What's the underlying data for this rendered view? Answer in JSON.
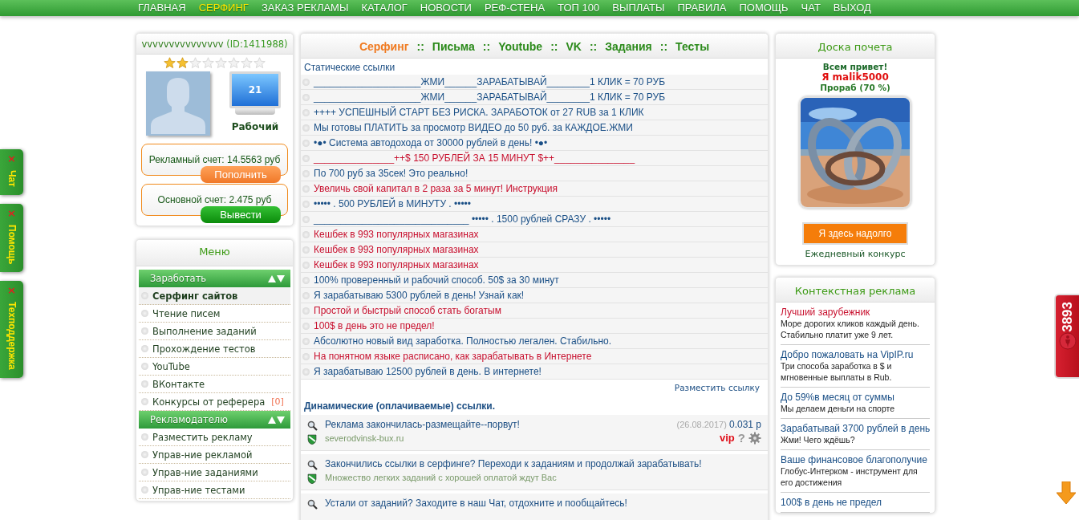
{
  "nav": [
    {
      "label": "ГЛАВНАЯ",
      "selected": false
    },
    {
      "label": "СЕРФИНГ",
      "selected": true
    },
    {
      "label": "ЗАКАЗ РЕКЛАМЫ",
      "selected": false
    },
    {
      "label": "КАТАЛОГ",
      "selected": false
    },
    {
      "label": "НОВОСТИ",
      "selected": false
    },
    {
      "label": "РЕФ-СТЕНА",
      "selected": false
    },
    {
      "label": "ТОП 100",
      "selected": false
    },
    {
      "label": "ВЫПЛАТЫ",
      "selected": false
    },
    {
      "label": "ПРАВИЛА",
      "selected": false
    },
    {
      "label": "ПОМОЩЬ",
      "selected": false
    },
    {
      "label": "ЧАТ",
      "selected": false
    },
    {
      "label": "ВЫХОД",
      "selected": false
    }
  ],
  "side_tabs": [
    {
      "label": "Чат",
      "close": "×"
    },
    {
      "label": "Помощь",
      "close": "×"
    },
    {
      "label": "Техподдержка",
      "close": "×"
    }
  ],
  "profile": {
    "username": "vvvvvvvvvvvvvvv",
    "id": "(ID:1411988)",
    "stars": 2,
    "monitor_value": "21",
    "status": "Рабочий",
    "accounts": [
      {
        "label": "Рекламный счет: 14.5563 руб",
        "button": "Пополнить",
        "kind": "deposit"
      },
      {
        "label": "Основной счет: 2.475 руб",
        "button": "Вывести",
        "kind": "withdraw"
      }
    ]
  },
  "menu": {
    "title": "Меню",
    "groups": [
      {
        "title": "Заработать",
        "items": [
          {
            "label": "Серфинг сайтов",
            "selected": true
          },
          {
            "label": "Чтение писем",
            "selected": false
          },
          {
            "label": "Выполнение заданий",
            "selected": false
          },
          {
            "label": "Прохождение тестов",
            "selected": false
          },
          {
            "label": "YouTube",
            "selected": false
          },
          {
            "label": "ВКонтакте",
            "selected": false
          },
          {
            "label": "Конкурсы от реферера",
            "selected": false,
            "badge": "[0]"
          }
        ]
      },
      {
        "title": "Рекламодателю",
        "items": [
          {
            "label": "Разместить рекламу",
            "selected": false
          },
          {
            "label": "Управ-ние рекламой",
            "selected": false
          },
          {
            "label": "Управ-ние заданиями",
            "selected": false
          },
          {
            "label": "Управ-ние тестами",
            "selected": false
          }
        ]
      }
    ]
  },
  "tabs": [
    {
      "label": "Серфинг",
      "selected": true
    },
    {
      "label": "Письма",
      "selected": false
    },
    {
      "label": "Youtube",
      "selected": false
    },
    {
      "label": "VK",
      "selected": false
    },
    {
      "label": "Задания",
      "selected": false
    },
    {
      "label": "Тесты",
      "selected": false
    }
  ],
  "tab_separator": "::",
  "static_links": {
    "title": "Статические ссылки",
    "place_link": "Разместить ссылку",
    "items": [
      {
        "text": "____________________ЖМИ______ЗАРАБАТЫВАЙ________1 КЛИК = 70 РУБ",
        "color": "#1a4f86"
      },
      {
        "text": "____________________ЖМИ______ЗАРАБАТЫВАЙ________1 КЛИК = 70 РУБ",
        "color": "#1a4f86"
      },
      {
        "text": "++++ УСПЕШНЫЙ СТАРТ БЕЗ РИСКА. ЗАРАБОТОК от 27 RUB за 1 КЛИК",
        "color": "#1a4f86"
      },
      {
        "text": "Мы готовы ПЛАТИТЬ за просмотр ВИДЕО до 50 руб. за КАЖДОЕ.ЖМИ",
        "color": "#1a4f86"
      },
      {
        "text": "•●• Система автодохода от 30000 рублей в день! •●•",
        "color": "#1a4f86"
      },
      {
        "text": "_______________++$ 150 РУБЛЕЙ ЗА 15 МИНУТ $++_______________",
        "color": "#c8102e"
      },
      {
        "text": "По 700 руб за 35сек! Это реально!",
        "color": "#1a4f86"
      },
      {
        "text": "Увеличь свой капитал в 2 раза за 5 минут! Инструкция",
        "color": "#c8102e"
      },
      {
        "text": "••••• . 500 РУБЛЕЙ в МИНУТУ . •••••",
        "color": "#1a4f86"
      },
      {
        "text": "_____________________________ ••••• . 1500 рублей СРАЗУ . •••••",
        "color": "#1a4f86"
      },
      {
        "text": "Кешбек в 993 популярных магазинах",
        "color": "#c8102e"
      },
      {
        "text": "Кешбек в 993 популярных магазинах",
        "color": "#c8102e"
      },
      {
        "text": "Кешбек в 993 популярных магазинах",
        "color": "#c8102e"
      },
      {
        "text": "100% проверенный и рабочий способ. 50$ за 30 минут",
        "color": "#1a4f86"
      },
      {
        "text": "Я зарабатываю 5300 рублей в день! Узнай как!",
        "color": "#1a4f86"
      },
      {
        "text": "Простой и быстрый способ стать богатым",
        "color": "#c8102e"
      },
      {
        "text": "100$ в день это не предел!",
        "color": "#c8102e"
      },
      {
        "text": "Абсолютно новый вид заработка. Полностью легален. Стабильно.",
        "color": "#1a4f86"
      },
      {
        "text": "На понятном языке расписано, как зарабатывать в Интернете",
        "color": "#c8102e"
      },
      {
        "text": "Я зарабатываю 12500 рублей в день. В интернете!",
        "color": "#1a4f86"
      }
    ]
  },
  "dynamic_links": {
    "title": "Динамические (оплачиваемые) ссылки.",
    "items": [
      {
        "title": "Реклама закончилась-размещайте--порвут!",
        "subtitle": "severodvinsk-bux.ru",
        "date": "(26.08.2017)",
        "price": "0.031 р",
        "vip": "vip",
        "help": "?"
      },
      {
        "title": "Закончились ссылки в серфинге? Переходи к заданиям и продолжай зарабатывать!",
        "subtitle": "Множество легких заданий с хорошей оплатой ждут Вас"
      },
      {
        "title": "Устали от заданий? Заходите в наш Чат, отдохните и пообщайтесь!"
      }
    ]
  },
  "honor_board": {
    "title": "Доска почета",
    "greeting": "Всем привет!",
    "name": "Я malik5000",
    "rank": "Прораб (70 %)",
    "button": "Я здесь надолго",
    "caption": "Ежедневный конкурс"
  },
  "context_ads": {
    "title": "Контекстная реклама",
    "items": [
      {
        "title": "Лучший зарубежник",
        "text": "Море дорогих кликов каждый день. Стабильно платит уже 9 лет.",
        "color": "#c8102e"
      },
      {
        "title": "Добро пожаловать на VipIP.ru",
        "text": "Три способа заработка в $ и мгновенные выплаты в Rub.",
        "color": "#1a4f86"
      },
      {
        "title": "До 59%в месяц от суммы",
        "text": "Мы делаем деньги на спорте",
        "color": "#1a4f86"
      },
      {
        "title": "Зарабатывай 3700 рублей в день",
        "text": "Жми! Чего ждёшь?",
        "color": "#1a4f86"
      },
      {
        "title": "Ваше финансовое благополучие",
        "text": "Глобус-Интерком - инструмент для его достижения",
        "color": "#1a4f86"
      },
      {
        "title": "100$ в день не предел",
        "color": "#1a4f86"
      }
    ]
  },
  "counter": "3893"
}
